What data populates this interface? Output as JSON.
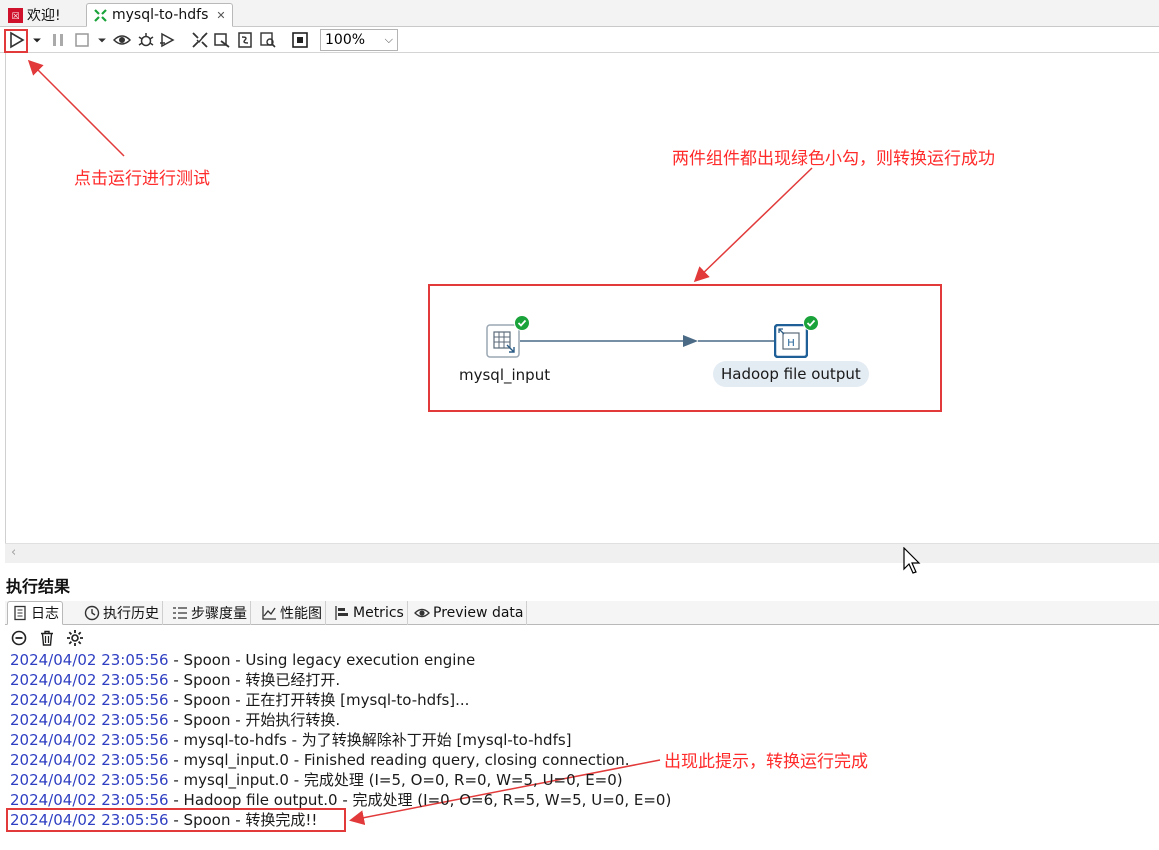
{
  "editor_tabs": [
    {
      "label": "欢迎!",
      "active": false
    },
    {
      "label": "mysql-to-hdfs",
      "active": true
    }
  ],
  "toolbar": {
    "zoom_value": "100%",
    "icons": [
      "run-icon",
      "run-dropdown-icon",
      "pause-icon",
      "stop-icon",
      "stop-dropdown-icon",
      "preview-icon",
      "debug-icon",
      "replay-icon",
      "verify-icon",
      "impact-icon",
      "sql-icon",
      "explore-db-icon",
      "show-results-icon"
    ]
  },
  "canvas": {
    "steps": [
      {
        "name": "mysql_input",
        "status": "success"
      },
      {
        "name": "Hadoop file output",
        "status": "success"
      }
    ],
    "annotations": {
      "run_hint": "点击运行进行测试",
      "success_hint": "两件组件都出现绿色小勾，则转换运行成功",
      "log_hint": "出现此提示，转换运行完成"
    }
  },
  "results": {
    "title": "执行结果",
    "tabs": [
      {
        "label": "日志",
        "icon": "log-icon",
        "active": true
      },
      {
        "label": "执行历史",
        "icon": "history-icon",
        "active": false
      },
      {
        "label": "步骤度量",
        "icon": "step-metrics-icon",
        "active": false
      },
      {
        "label": "性能图",
        "icon": "performance-chart-icon",
        "active": false
      },
      {
        "label": "Metrics",
        "icon": "metrics-icon",
        "active": false
      },
      {
        "label": "Preview data",
        "icon": "preview-data-icon",
        "active": false
      }
    ],
    "log_lines": [
      {
        "ts": "2024/04/02 23:05:56",
        "msg": " - Spoon - Using legacy execution engine"
      },
      {
        "ts": "2024/04/02 23:05:56",
        "msg": " - Spoon - 转换已经打开."
      },
      {
        "ts": "2024/04/02 23:05:56",
        "msg": " - Spoon - 正在打开转换 [mysql-to-hdfs]..."
      },
      {
        "ts": "2024/04/02 23:05:56",
        "msg": " - Spoon - 开始执行转换."
      },
      {
        "ts": "2024/04/02 23:05:56",
        "msg": " - mysql-to-hdfs - 为了转换解除补丁开始  [mysql-to-hdfs]"
      },
      {
        "ts": "2024/04/02 23:05:56",
        "msg": " - mysql_input.0 - Finished reading query, closing connection."
      },
      {
        "ts": "2024/04/02 23:05:56",
        "msg": " - mysql_input.0 - 完成处理 (I=5, O=0, R=0, W=5, U=0, E=0)"
      },
      {
        "ts": "2024/04/02 23:05:56",
        "msg": " - Hadoop file output.0 - 完成处理 (I=0, O=6, R=5, W=5, U=0, E=0)"
      },
      {
        "ts": "2024/04/02 23:05:56",
        "msg": " - Spoon - 转换完成!!"
      }
    ]
  },
  "colors": {
    "annotation_red": "#ff2a2a",
    "success_green": "#1aa33b",
    "timestamp_blue": "#2f3fc2",
    "hop_color": "#4a6a85"
  }
}
